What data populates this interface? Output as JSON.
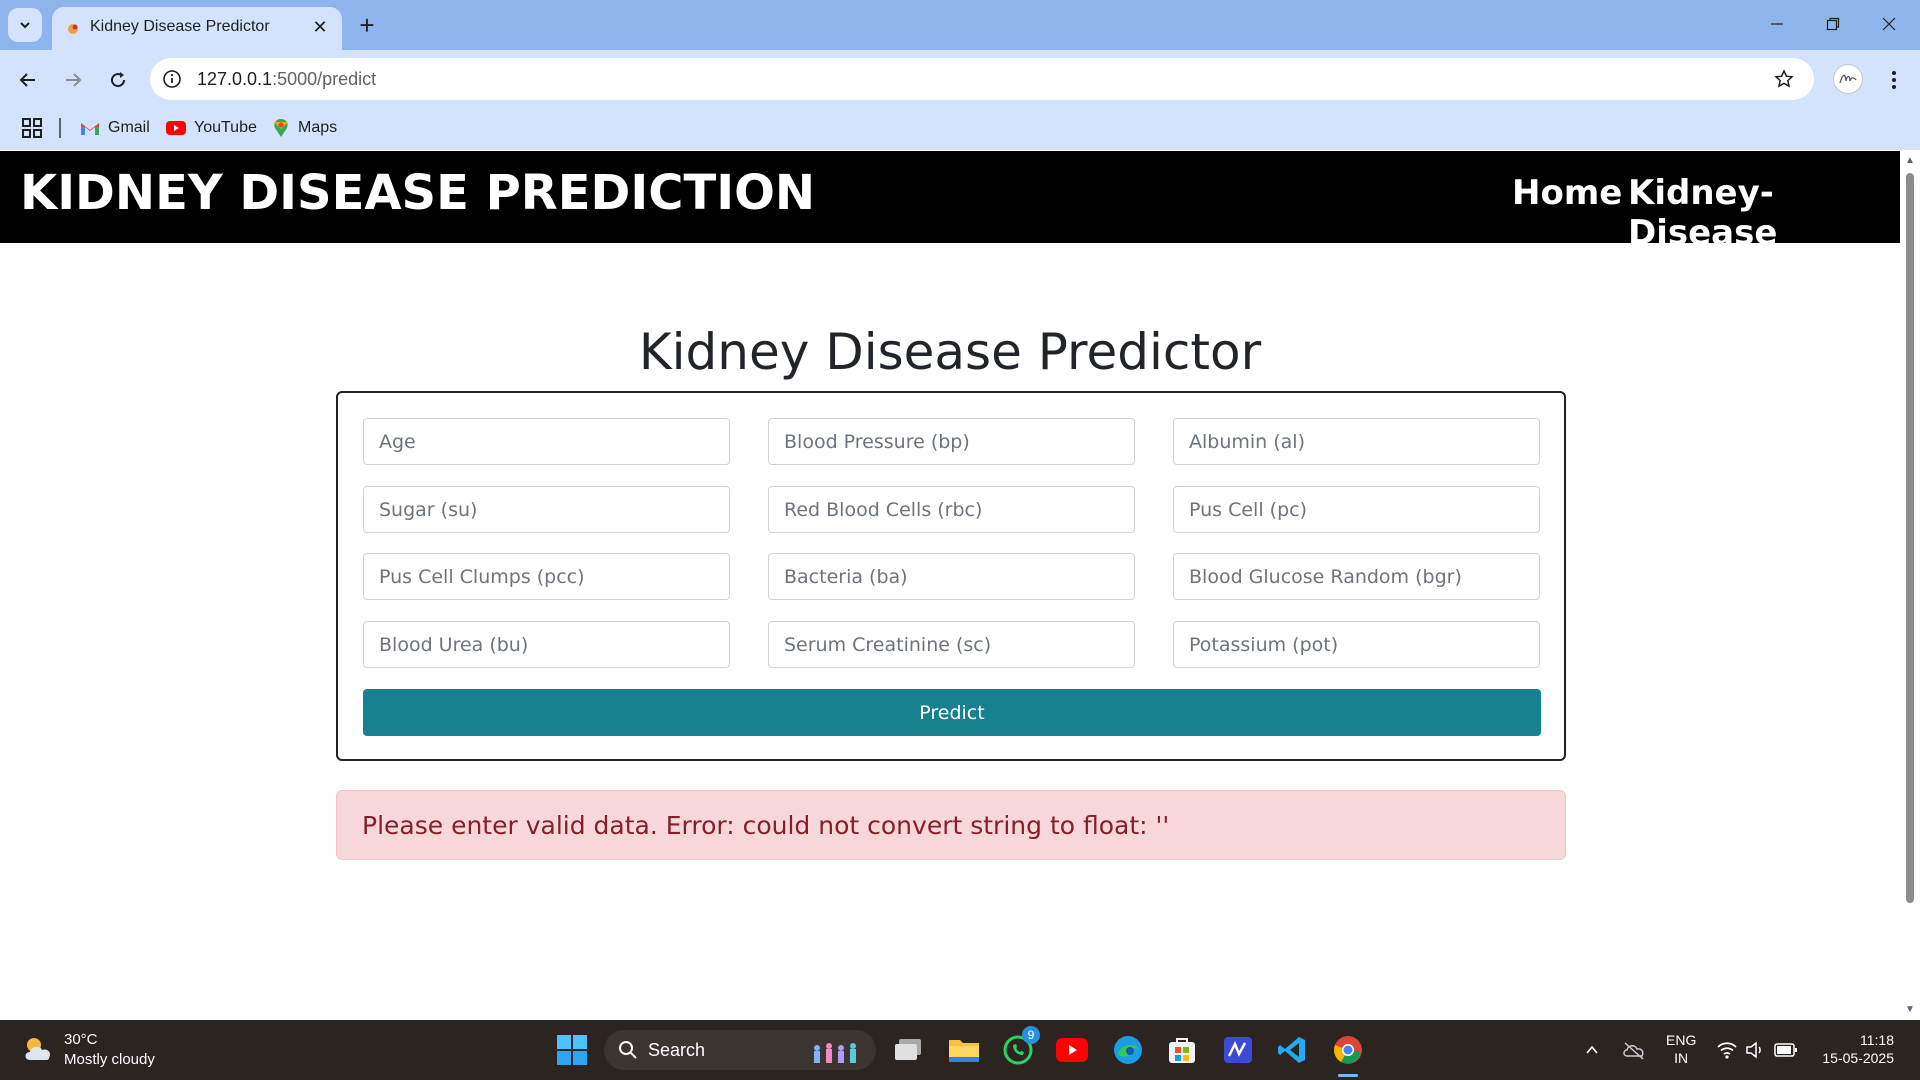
{
  "browser": {
    "tab_title": "Kidney Disease Predictor",
    "url_host": "127.0.0.1",
    "url_rest": ":5000/predict",
    "bookmarks": [
      {
        "label": "Gmail",
        "icon": "gmail-icon"
      },
      {
        "label": "YouTube",
        "icon": "youtube-icon"
      },
      {
        "label": "Maps",
        "icon": "maps-icon"
      }
    ]
  },
  "navbar": {
    "brand": "KIDNEY DISEASE PREDICTION",
    "links": [
      "Home",
      "Kidney-Disease"
    ]
  },
  "main": {
    "heading": "Kidney Disease Predictor",
    "fields": [
      "Age",
      "Blood Pressure (bp)",
      "Albumin (al)",
      "Sugar (su)",
      "Red Blood Cells (rbc)",
      "Pus Cell (pc)",
      "Pus Cell Clumps (pcc)",
      "Bacteria (ba)",
      "Blood Glucose Random (bgr)",
      "Blood Urea (bu)",
      "Serum Creatinine (sc)",
      "Potassium (pot)"
    ],
    "predict_label": "Predict",
    "error_message": "Please enter valid data. Error: could not convert string to float: ''"
  },
  "taskbar": {
    "weather_temp": "30°C",
    "weather_desc": "Mostly cloudy",
    "search_label": "Search",
    "whatsapp_badge": "9",
    "lang_line1": "ENG",
    "lang_line2": "IN",
    "time": "11:18",
    "date": "15-05-2025"
  },
  "colors": {
    "navbar_bg": "#000000",
    "predict_button": "#17818f",
    "alert_bg": "#f8d7da",
    "alert_text": "#842029",
    "tabstrip": "#8eb4ec",
    "toolbar": "#d3e3fd",
    "taskbar": "#2b2421"
  }
}
